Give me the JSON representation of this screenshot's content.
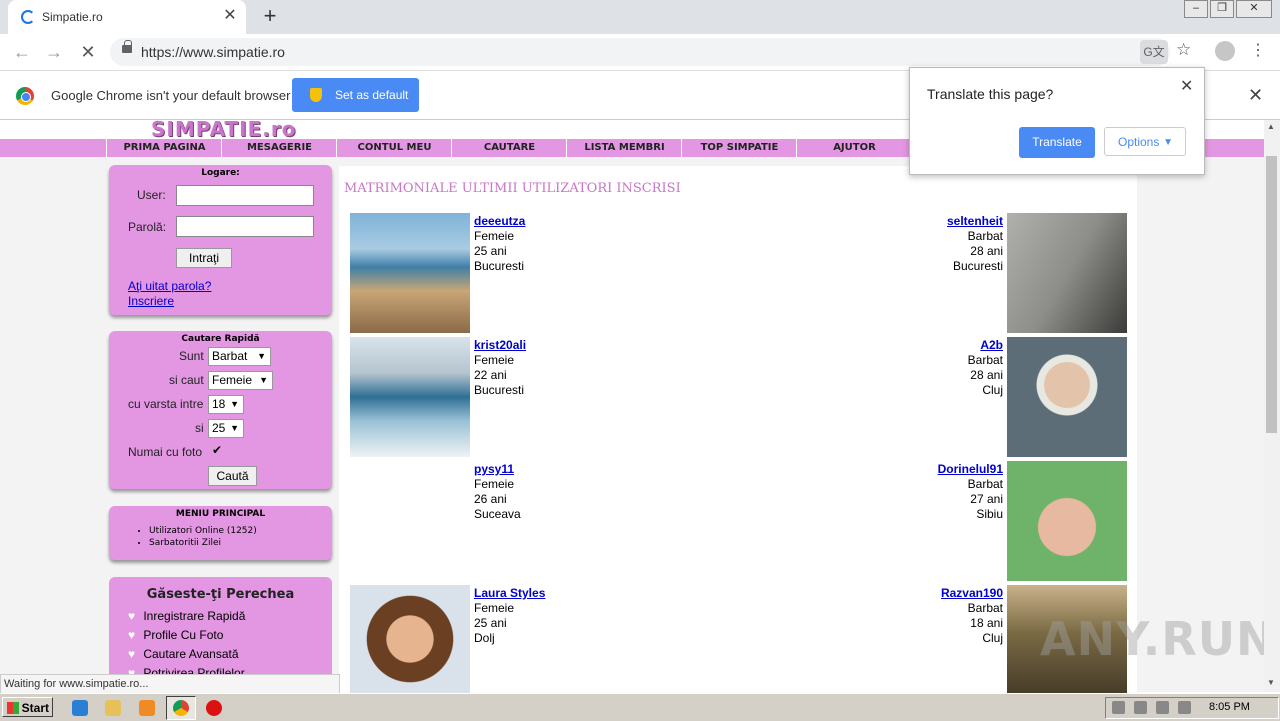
{
  "browser": {
    "tab_title": "Simpatie.ro",
    "url": "https://www.simpatie.ro",
    "default_bar_message": "Google Chrome isn't your default browser",
    "set_default_label": "Set as default"
  },
  "translate_popup": {
    "title": "Translate this page?",
    "translate_label": "Translate",
    "options_label": "Options"
  },
  "site": {
    "logo": "SIMPATIE.ro",
    "nav": [
      "PRIMA PAGINA",
      "MESAGERIE",
      "CONTUL MEU",
      "CAUTARE",
      "LISTA MEMBRI",
      "TOP SIMPATIE",
      "AJUTOR"
    ],
    "login": {
      "title": "Logare:",
      "user_label": "User:",
      "pass_label": "Parolă:",
      "submit": "Intraţi",
      "forgot": "Aţi uitat parola?",
      "register": "Inscriere"
    },
    "quick_search": {
      "title": "Cautare Rapidă",
      "sunt_label": "Sunt",
      "sunt_value": "Barbat",
      "caut_label": "si caut",
      "caut_value": "Femeie",
      "age_label": "cu varsta intre",
      "age_from": "18",
      "si_label": "si",
      "age_to": "25",
      "photo_label": "Numai cu foto",
      "submit": "Caută"
    },
    "main_menu": {
      "title": "MENIU PRINCIPAL",
      "items": [
        "Utilizatori Online (1252)",
        "Sarbatoritii Zilei"
      ]
    },
    "find_partner": {
      "title": "Găseste-ţi Perechea",
      "items": [
        "Inregistrare Rapidă",
        "Profile Cu Foto",
        "Cautare Avansată",
        "Potrivirea Profilelor"
      ]
    },
    "content_title": "MATRIMONIALE ULTIMII UTILIZATORI INSCRISI",
    "profiles_left": [
      {
        "name": "deeeutza",
        "gender": "Femeie",
        "age": "25 ani",
        "city": "Bucuresti"
      },
      {
        "name": "krist20ali",
        "gender": "Femeie",
        "age": "22 ani",
        "city": "Bucuresti"
      },
      {
        "name": "pysy11",
        "gender": "Femeie",
        "age": "26 ani",
        "city": "Suceava"
      },
      {
        "name": "Laura Styles",
        "gender": "Femeie",
        "age": "25 ani",
        "city": "Dolj"
      }
    ],
    "profiles_right": [
      {
        "name": "seltenheit",
        "gender": "Barbat",
        "age": "28 ani",
        "city": "Bucuresti"
      },
      {
        "name": "A2b",
        "gender": "Barbat",
        "age": "28 ani",
        "city": "Cluj"
      },
      {
        "name": "Dorinelul91",
        "gender": "Barbat",
        "age": "27 ani",
        "city": "Sibiu"
      },
      {
        "name": "Razvan190",
        "gender": "Barbat",
        "age": "18 ani",
        "city": "Cluj"
      }
    ]
  },
  "status_text": "Waiting for www.simpatie.ro...",
  "watermark": "ANY.RUN",
  "taskbar": {
    "start_label": "Start",
    "clock": "8:05 PM"
  }
}
